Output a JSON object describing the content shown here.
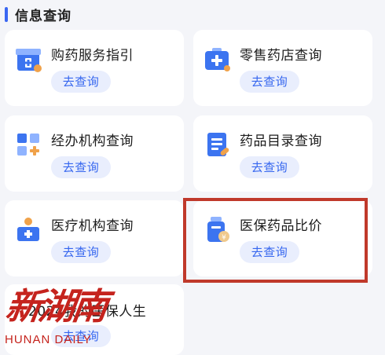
{
  "section": {
    "title": "信息查询"
  },
  "cards": [
    {
      "title": "购药服务指引",
      "button": "去查询",
      "icon": "pharmacy-building-icon"
    },
    {
      "title": "零售药店查询",
      "button": "去查询",
      "icon": "medical-kit-icon"
    },
    {
      "title": "经办机构查询",
      "button": "去查询",
      "icon": "grid-plus-icon"
    },
    {
      "title": "药品目录查询",
      "button": "去查询",
      "icon": "drug-list-icon"
    },
    {
      "title": "医疗机构查询",
      "button": "去查询",
      "icon": "hospital-icon"
    },
    {
      "title": "医保药品比价",
      "button": "去查询",
      "icon": "medicine-bottle-price-icon"
    },
    {
      "title": "2024我的医保人生",
      "button": "去查询",
      "icon": ""
    }
  ],
  "watermark": {
    "chinese": "新湖南",
    "english": "HUNAN DAILY"
  },
  "colors": {
    "accent": "#3566ef",
    "highlight": "#c0392b",
    "watermark": "#c5231d"
  }
}
